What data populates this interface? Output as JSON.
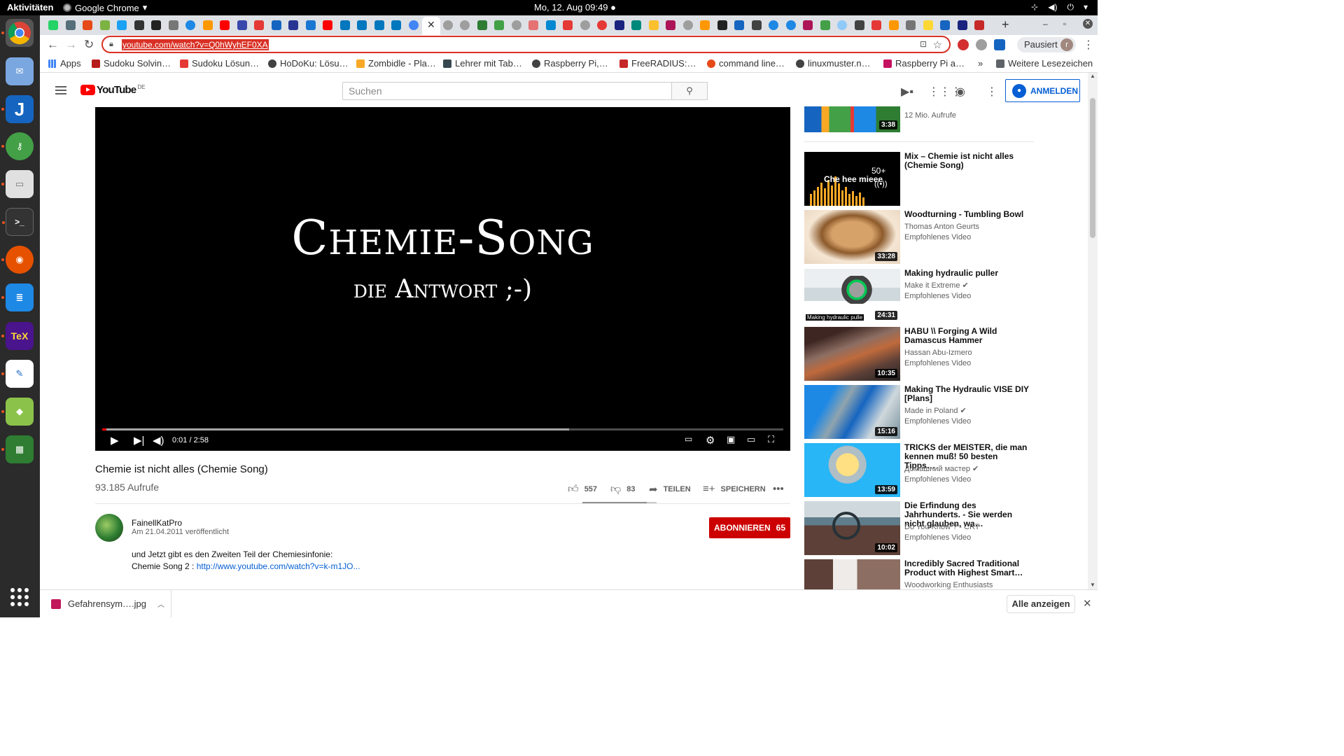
{
  "system": {
    "activities": "Aktivitäten",
    "app_name": "Google Chrome",
    "clock": "Mo, 12. Aug  09:49 ●"
  },
  "browser": {
    "url": "youtube.com/watch?v=Q0hWyhEF0XA",
    "profile_label": "Pausiert",
    "profile_initial": "r",
    "bookmarks": [
      {
        "label": "Apps",
        "color": "#4285f4"
      },
      {
        "label": "Sudoku Solvin…",
        "color": "#b71c1c"
      },
      {
        "label": "Sudoku Lösun…",
        "color": "#e53935"
      },
      {
        "label": "HoDoKu: Lösu…",
        "color": "#424242"
      },
      {
        "label": "Zombidle - Pla…",
        "color": "#f9a825"
      },
      {
        "label": "Lehrer mit Tab…",
        "color": "#37474f"
      },
      {
        "label": "Raspberry Pi,…",
        "color": "#424242"
      },
      {
        "label": "FreeRADIUS:…",
        "color": "#c62828"
      },
      {
        "label": "command line…",
        "color": "#e64a19"
      },
      {
        "label": "linuxmuster.n…",
        "color": "#424242"
      },
      {
        "label": "Raspberry Pi a…",
        "color": "#c51162"
      }
    ],
    "more_bookmarks": "»",
    "other_bookmarks": "Weitere Lesezeichen"
  },
  "youtube": {
    "logo_text": "YouTube",
    "region": "DE",
    "search_placeholder": "Suchen",
    "signin_label": "ANMELDEN",
    "player": {
      "title_line1": "Chemie-Song",
      "title_line2": "die Antwort ;-)",
      "time": "0:01 / 2:58",
      "played_fraction": 0.006,
      "loaded_fraction": 0.685
    },
    "video": {
      "title": "Chemie ist nicht alles (Chemie Song)",
      "views": "93.185 Aufrufe",
      "likes": "557",
      "dislikes": "83",
      "like_fraction": 0.87,
      "share_label": "TEILEN",
      "save_label": "SPEICHERN"
    },
    "channel": {
      "name": "FainellKatPro",
      "published": "Am 21.04.2011 veröffentlicht",
      "subscribe_label": "ABONNIEREN",
      "subscriber_count": "65"
    },
    "description": {
      "line1": "und Jetzt gibt es den Zweiten Teil der Chemiesinfonie:",
      "line2_prefix": "Chemie Song 2 : ",
      "line2_link": "http://www.youtube.com/watch?v=k-m1JO..."
    },
    "related": [
      {
        "title": "",
        "meta1": "12 Mio. Aufrufe",
        "meta2": "",
        "duration": "3:38"
      },
      {
        "title": "Mix – Chemie ist nicht alles (Chemie Song)",
        "meta1": "",
        "meta2": "",
        "duration": "",
        "overlay_text": "Che hee mieee",
        "overlay_count": "50+"
      },
      {
        "title": "Woodturning - Tumbling Bowl",
        "meta1": "Thomas Anton Geurts",
        "meta2": "Empfohlenes Video",
        "duration": "33:28"
      },
      {
        "title": "Making hydraulic puller",
        "meta1": "Make it Extreme ✔",
        "meta2": "Empfohlenes Video",
        "duration": "24:31",
        "overlay_text": "Making hydraulic pulle"
      },
      {
        "title": "HABU \\\\ Forging A Wild Damascus Hammer",
        "meta1": "Hassan Abu-Izmero",
        "meta2": "Empfohlenes Video",
        "duration": "10:35"
      },
      {
        "title": "Making The Hydraulic VISE DIY [Plans]",
        "meta1": "Made in Poland ✔",
        "meta2": "Empfohlenes Video",
        "duration": "15:16"
      },
      {
        "title": "TRICKS der MEISTER, die man kennen muß! 50 besten Tipps…",
        "meta1": "Домашний мастер ✔",
        "meta2": "Empfohlenes Video",
        "duration": "13:59"
      },
      {
        "title": "Die Erfindung des Jahrhunderts. - Sie werden nicht glauben, wa…",
        "meta1": "Do You Know ? - CRT",
        "meta2": "Empfohlenes Video",
        "duration": "10:02"
      },
      {
        "title": "Incredibly Sacred Traditional Product with Highest Smart…",
        "meta1": "Woodworking Enthusiasts",
        "meta2": "",
        "duration": ""
      }
    ]
  },
  "downloads": {
    "file_name": "Gefahrensym….jpg",
    "show_all_label": "Alle anzeigen"
  },
  "colors": {
    "accent_red": "#d93025",
    "youtube_red": "#ff0000",
    "subscribe_red": "#cc0000",
    "link_blue": "#065fd4"
  }
}
